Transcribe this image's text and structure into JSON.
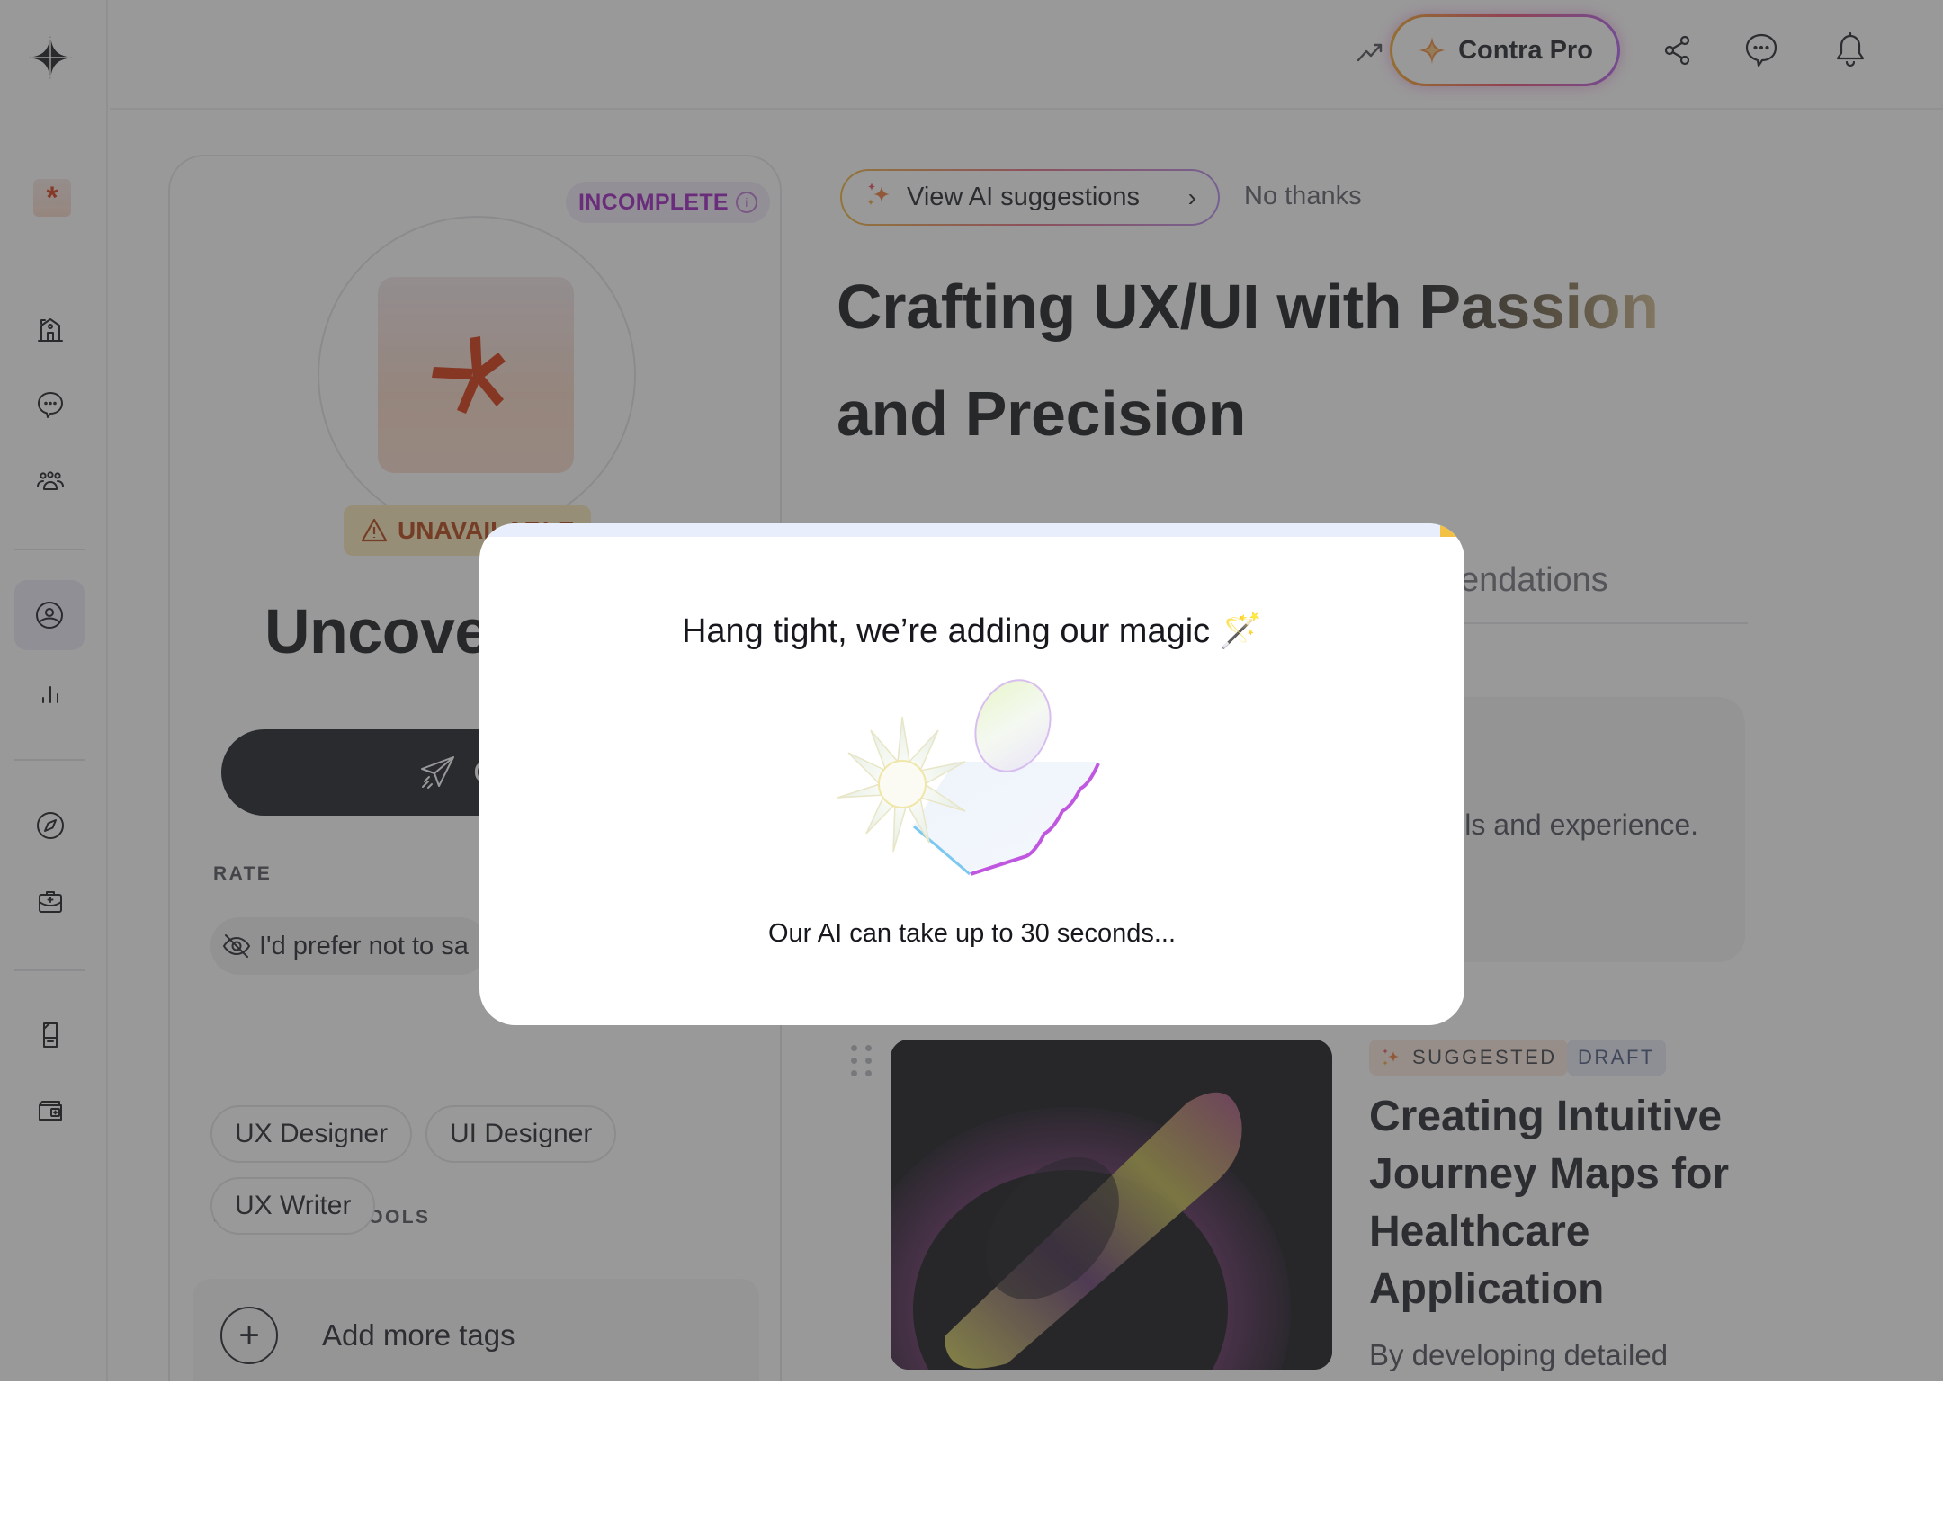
{
  "sidebar": {
    "items": [
      {
        "name": "home",
        "icon": "home-icon"
      },
      {
        "name": "messages",
        "icon": "chat-bubble-icon"
      },
      {
        "name": "community",
        "icon": "people-icon"
      },
      {
        "name": "profile",
        "icon": "user-circle-icon",
        "active": true
      },
      {
        "name": "analytics",
        "icon": "bar-chart-icon"
      },
      {
        "name": "discover",
        "icon": "compass-icon"
      },
      {
        "name": "jobs",
        "icon": "briefcase-icon"
      },
      {
        "name": "documents",
        "icon": "document-icon"
      },
      {
        "name": "wallet",
        "icon": "wallet-icon"
      }
    ]
  },
  "header": {
    "trend_count": "0",
    "pro_label": "Contra Pro"
  },
  "profile": {
    "status_badge": "INCOMPLETE",
    "availability": "UNAVAILABLE",
    "name_visible": "Uncove",
    "cta_label": "Get I",
    "rate_label": "RATE",
    "rate_value": "I'd prefer not to sa",
    "skills_label": "SKILLS AND TOOLS",
    "skills": [
      "UX Designer",
      "UI Designer",
      "UX Writer"
    ],
    "add_tags_label": "Add more tags"
  },
  "main": {
    "ai_button_label": "View AI suggestions",
    "no_thanks_label": "No thanks",
    "headline_plain": "Crafting UX/UI with ",
    "headline_grad": "Passion",
    "headline_line2": "and Precision",
    "tab_visible": "endations",
    "info_card_text": "ls and experience.",
    "project": {
      "badge_suggested": "SUGGESTED",
      "badge_draft": "DRAFT",
      "title": "Creating Intuitive Journey Maps for Healthcare Application",
      "description": "By developing detailed"
    }
  },
  "modal": {
    "title": "Hang tight, we’re adding our magic 🪄",
    "subtitle": "Our AI can take up to 30 seconds...",
    "progress_percent": 2.5,
    "colors": {
      "track": "#e8eefb",
      "fill": "#f3c244"
    }
  },
  "colors": {
    "accent_purple": "#9b1fc0",
    "warning": "#b3400e",
    "notification_dot": "#ef3b3b",
    "dark_button": "#161a23"
  }
}
